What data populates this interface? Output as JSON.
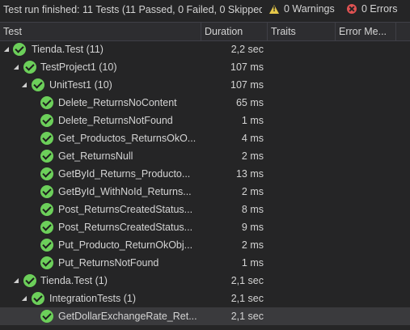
{
  "status": {
    "summary": "Test run finished: 11 Tests (11 Passed, 0 Failed, 0 Skipped",
    "warnings": "0 Warnings",
    "errors": "0 Errors"
  },
  "columns": {
    "test": "Test",
    "duration": "Duration",
    "traits": "Traits",
    "error_message": "Error Me..."
  },
  "rows": [
    {
      "label": "Tienda.Test (11)",
      "duration": "2,2 sec"
    },
    {
      "label": "TestProject1 (10)",
      "duration": "107 ms"
    },
    {
      "label": "UnitTest1 (10)",
      "duration": "107 ms"
    },
    {
      "label": "Delete_ReturnsNoContent",
      "duration": "65 ms"
    },
    {
      "label": "Delete_ReturnsNotFound",
      "duration": "1 ms"
    },
    {
      "label": "Get_Productos_ReturnsOkO...",
      "duration": "4 ms"
    },
    {
      "label": "Get_ReturnsNull",
      "duration": "2 ms"
    },
    {
      "label": "GetById_Returns_Producto...",
      "duration": "13 ms"
    },
    {
      "label": "GetById_WithNoId_Returns...",
      "duration": "2 ms"
    },
    {
      "label": "Post_ReturnsCreatedStatus...",
      "duration": "8 ms"
    },
    {
      "label": "Post_ReturnsCreatedStatus...",
      "duration": "9 ms"
    },
    {
      "label": "Put_Producto_ReturnOkObj...",
      "duration": "2 ms"
    },
    {
      "label": "Put_ReturnsNotFound",
      "duration": "1 ms"
    },
    {
      "label": "Tienda.Test (1)",
      "duration": "2,1 sec"
    },
    {
      "label": "IntegrationTests (1)",
      "duration": "2,1 sec"
    },
    {
      "label": "GetDollarExchangeRate_Ret...",
      "duration": "2,1 sec"
    }
  ],
  "colors": {
    "pass": "#6ccf5a",
    "warning": "#e6c84a",
    "error": "#e05252",
    "selection": "#3a3a3d"
  },
  "icons": {
    "passed": "check-circle-icon",
    "expanded": "triangle-down-icon",
    "warning": "warning-triangle-icon",
    "error": "error-circle-icon"
  }
}
